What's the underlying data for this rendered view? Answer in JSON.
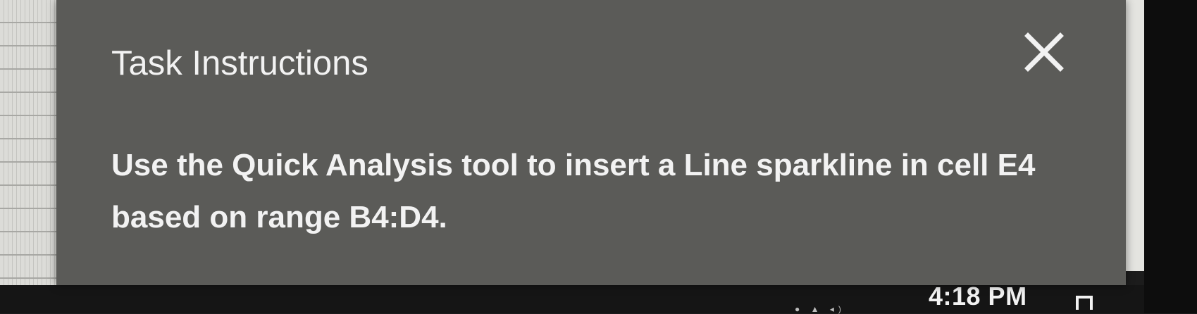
{
  "task_panel": {
    "title": "Task Instructions",
    "close_icon": "close-icon",
    "instruction": "Use the Quick Analysis tool to insert a Line sparkline in cell E4 based on range B4:D4."
  },
  "taskbar": {
    "time": "4:18 PM",
    "notification_icon": "notification-icon"
  },
  "colors": {
    "panel_background": "#5b5b58",
    "panel_text": "#f2f2f2",
    "taskbar_background": "#151515"
  }
}
